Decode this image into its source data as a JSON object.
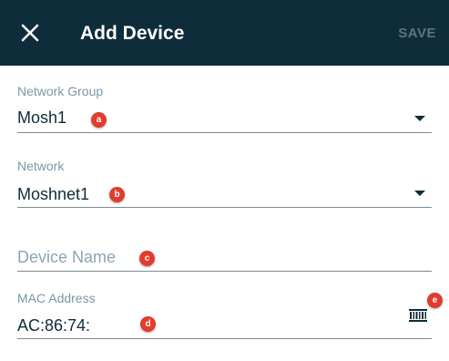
{
  "header": {
    "title": "Add Device",
    "save_label": "SAVE"
  },
  "form": {
    "network_group": {
      "label": "Network Group",
      "value": "Mosh1"
    },
    "network": {
      "label": "Network",
      "value": "Moshnet1"
    },
    "device_name": {
      "placeholder": "Device Name"
    },
    "mac_address": {
      "label": "MAC Address",
      "value": "AC:86:74:"
    }
  },
  "annotations": [
    "a",
    "b",
    "c",
    "d",
    "e"
  ],
  "colors": {
    "appbar": "#0e2c3a",
    "label": "#7a98a6",
    "badge": "#e23c2c",
    "save_disabled": "#5d7380"
  }
}
